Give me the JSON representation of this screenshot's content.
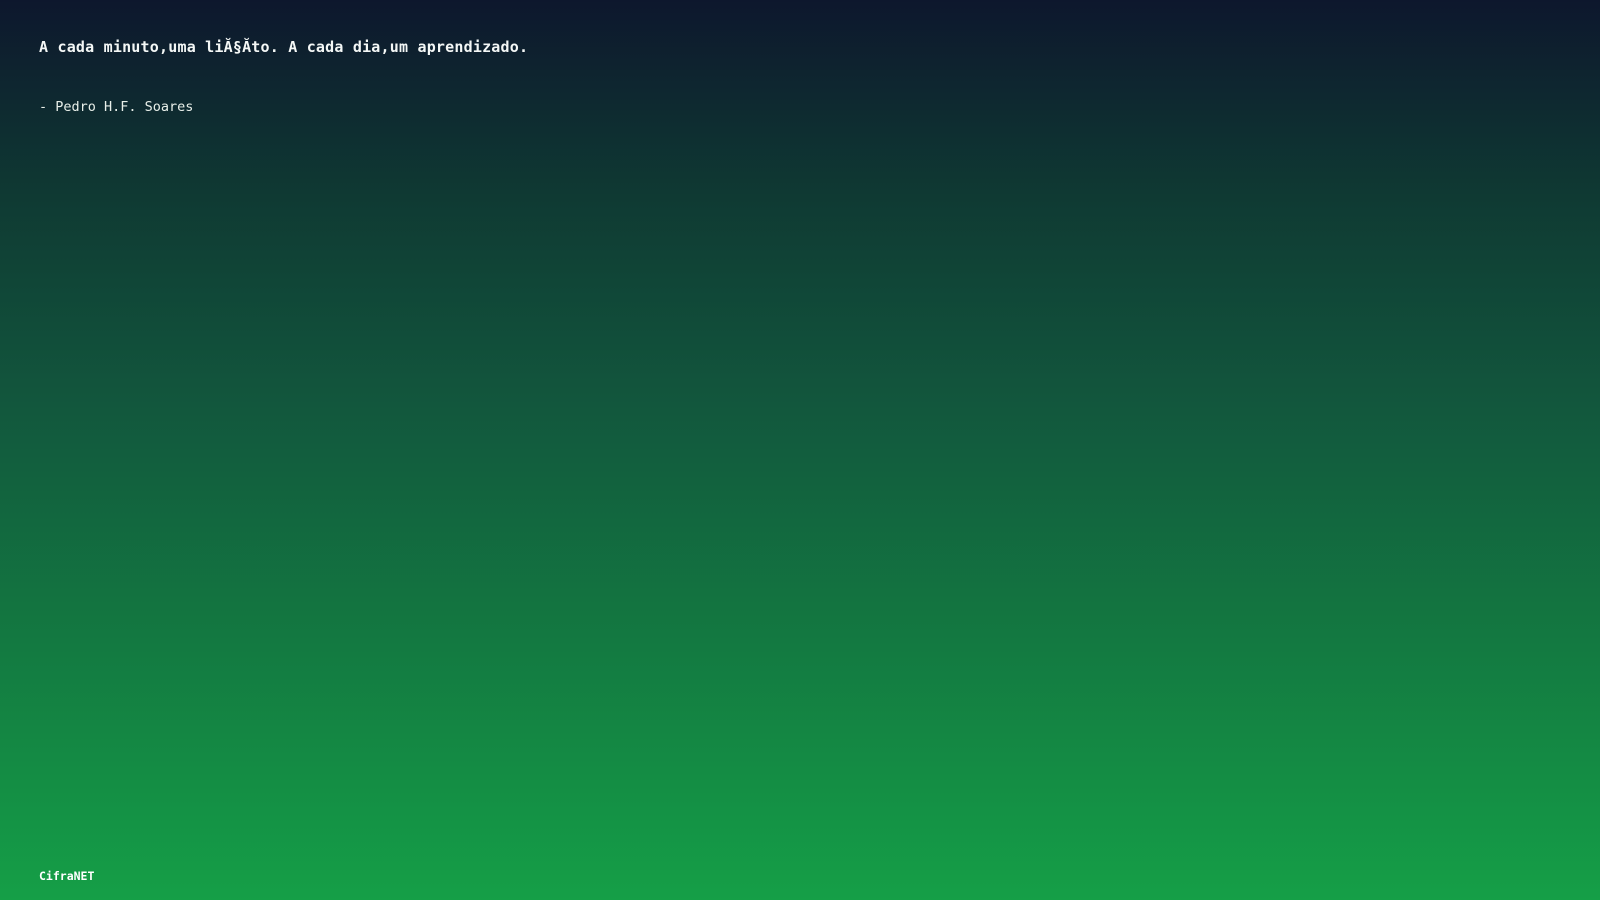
{
  "quote": {
    "text": "A cada minuto,uma liĂ§Ăto. A cada dia,um aprendizado.",
    "author": "- Pedro H.F. Soares"
  },
  "footer": {
    "brand": "CifraNET"
  },
  "colors": {
    "gradient_top": "#0d172d",
    "gradient_bottom": "#159f47",
    "text": "#ffffff"
  }
}
